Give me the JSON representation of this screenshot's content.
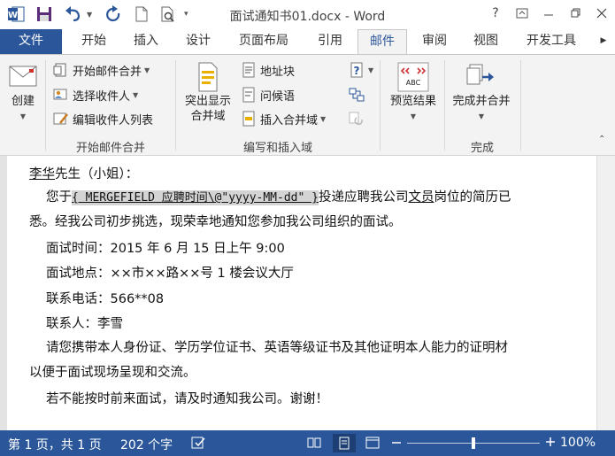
{
  "app": {
    "title": "面试通知书01.docx - Word",
    "help": "?",
    "accent": "#2b579a"
  },
  "tabs": [
    {
      "label": "文件"
    },
    {
      "label": "开始"
    },
    {
      "label": "插入"
    },
    {
      "label": "设计"
    },
    {
      "label": "页面布局"
    },
    {
      "label": "引用"
    },
    {
      "label": "邮件"
    },
    {
      "label": "审阅"
    },
    {
      "label": "视图"
    },
    {
      "label": "开发工具"
    }
  ],
  "ribbon": {
    "create": {
      "label": "创建"
    },
    "start_merge": {
      "start": "开始邮件合并",
      "select": "选择收件人",
      "edit": "编辑收件人列表",
      "group": "开始邮件合并"
    },
    "write_insert": {
      "highlight_line1": "突出显示",
      "highlight_line2": "合并域",
      "address": "地址块",
      "greeting": "问候语",
      "insert_field": "插入合并域",
      "group": "编写和插入域"
    },
    "preview": {
      "label": "预览结果",
      "icon_text": "ABC",
      "group": ""
    },
    "finish": {
      "label": "完成并合并",
      "group": "完成"
    }
  },
  "document": {
    "line1_name": "李华",
    "line1_rest": "先生（小姐）：",
    "line2_pre": "您于",
    "line2_field": "{ MERGEFIELD 应聘时间\\@\"yyyy-MM-dd\" }",
    "line2_mid": "投递应聘我公司",
    "line2_job": "文员",
    "line2_post": "岗位的简历已",
    "line3": "悉。经我公司初步挑选，现荣幸地通知您参加我公司组织的面试。",
    "line4": "面试时间：2015 年 6 月 15 日上午 9:00",
    "line5": "面试地点：××市××路××号 1 楼会议大厅",
    "line6": "联系电话：566**08",
    "line7": "联系人：李雪",
    "line8": "请您携带本人身份证、学历学位证书、英语等级证书及其他证明本人能力的证明材",
    "line9": "以便于面试现场呈现和交流。",
    "line10": "若不能按时前来面试，请及时通知我公司。谢谢！"
  },
  "status": {
    "page": "第 1 页，共 1 页",
    "words": "202 个字",
    "zoom": "100%"
  }
}
